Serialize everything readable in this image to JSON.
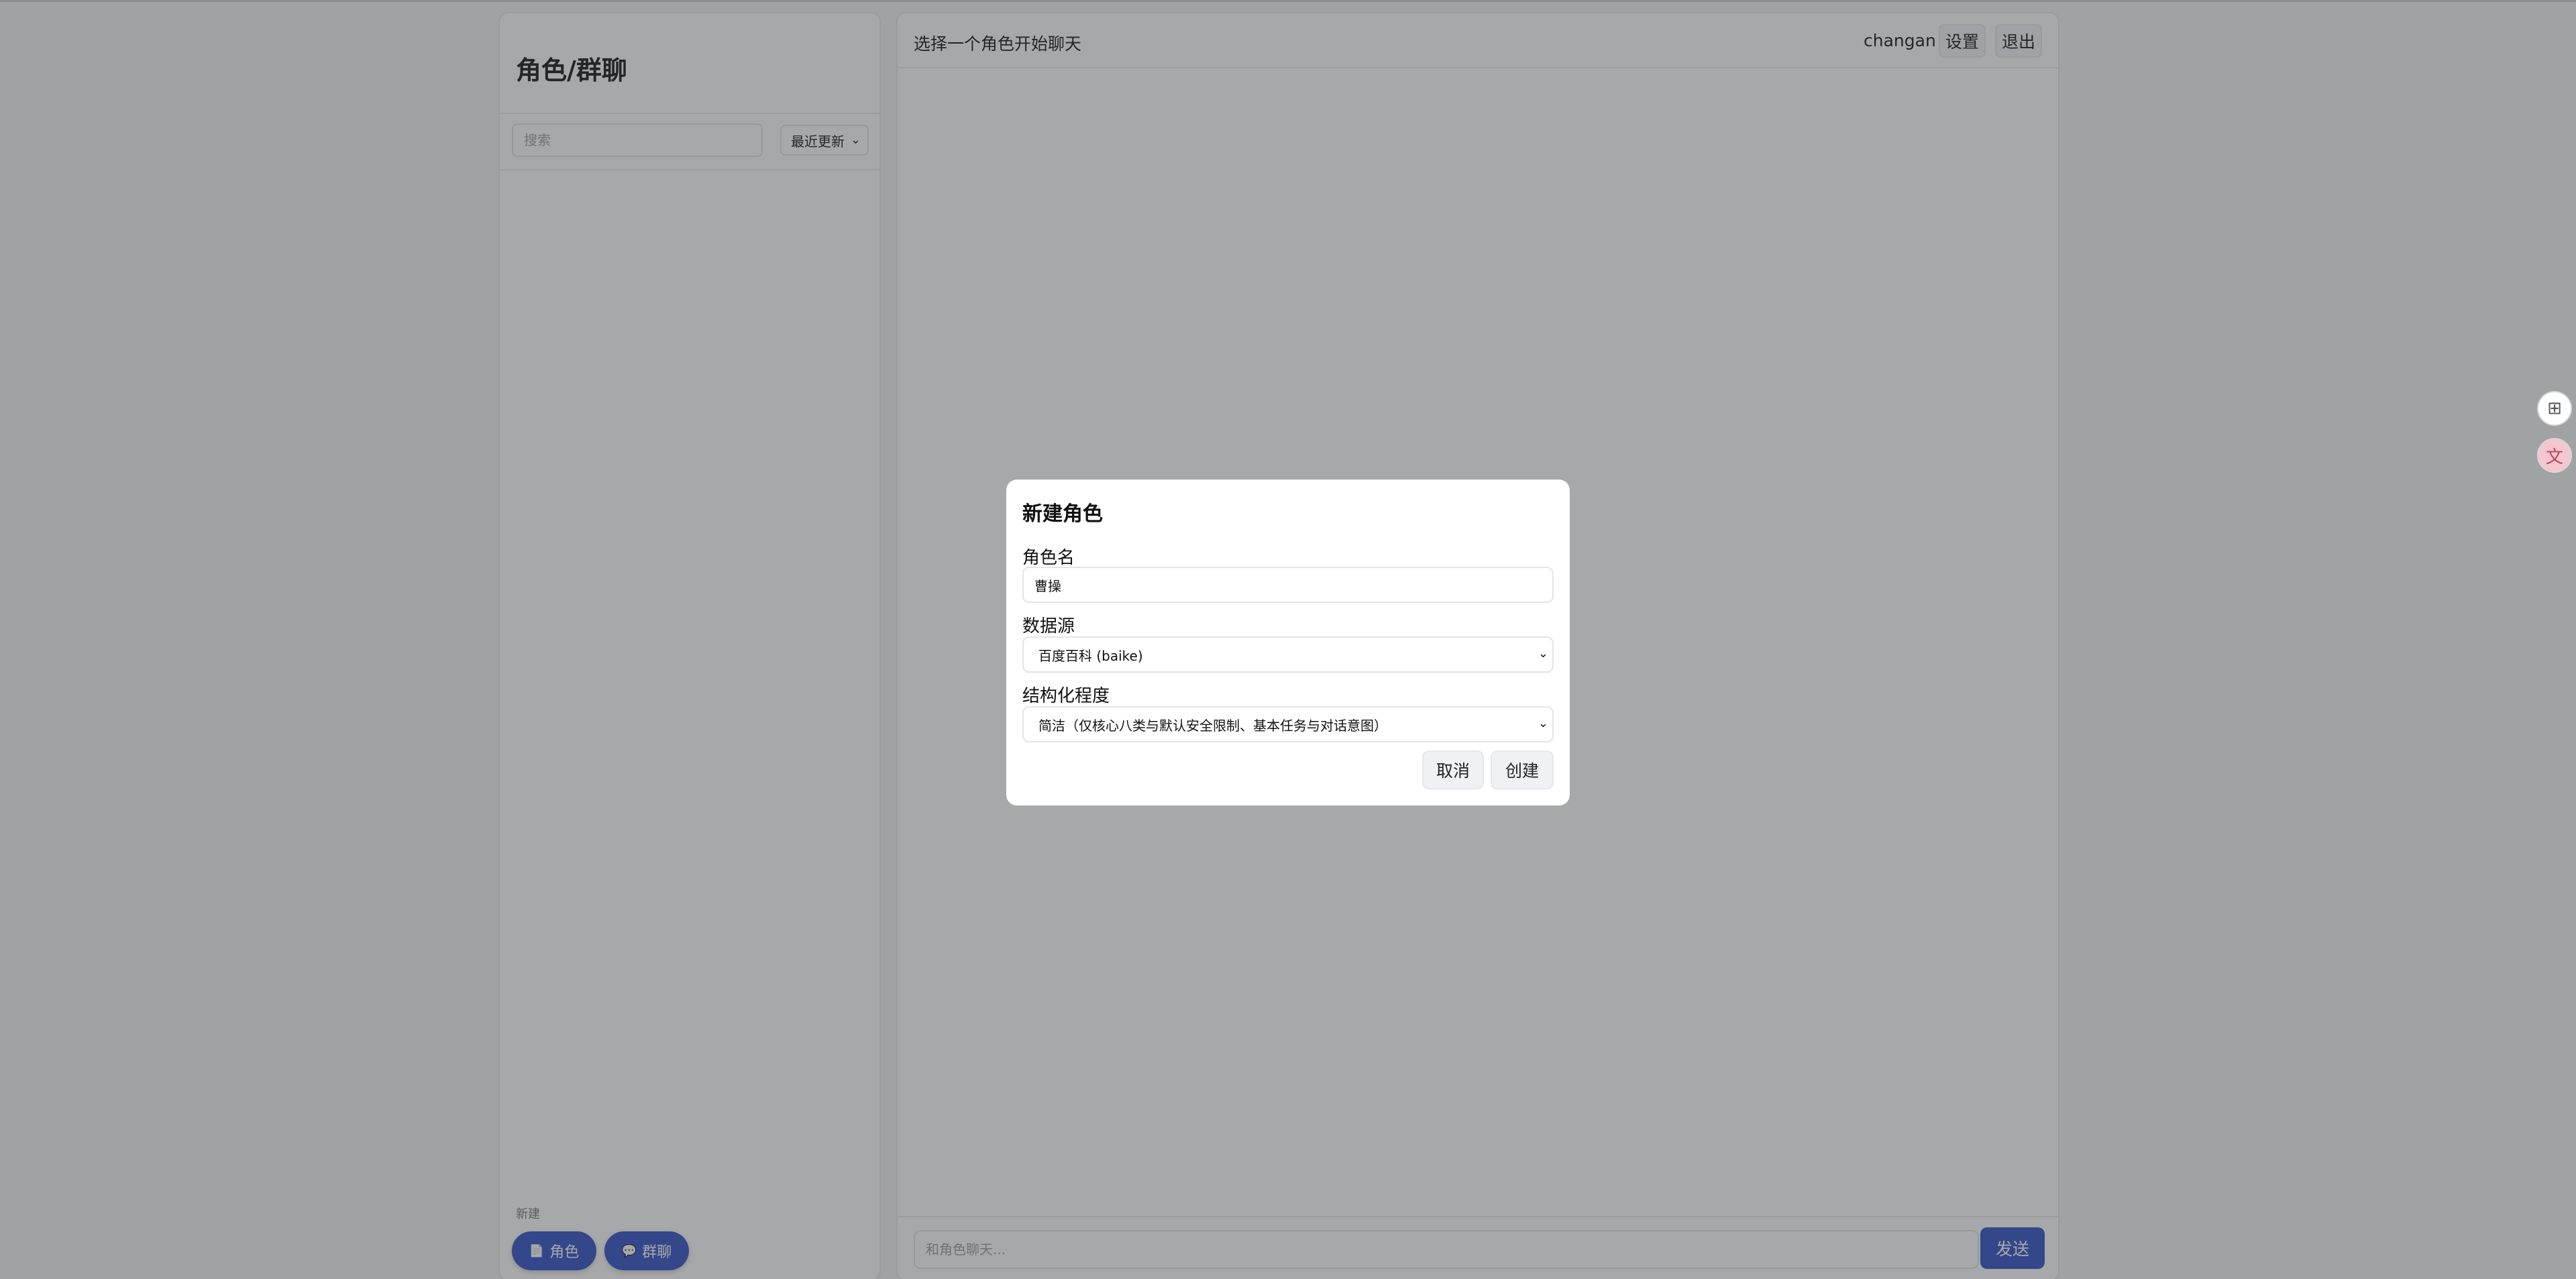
{
  "sidebar": {
    "title": "角色/群聊",
    "search_placeholder": "搜索",
    "sort_value": "最近更新",
    "new_label": "新建",
    "new_role_label": "角色",
    "new_group_label": "群聊"
  },
  "chat": {
    "header_title": "选择一个角色开始聊天",
    "username": "changan",
    "settings_label": "设置",
    "logout_label": "退出",
    "input_placeholder": "和角色聊天...",
    "send_label": "发送"
  },
  "modal": {
    "title": "新建角色",
    "name_label": "角色名",
    "name_value": "曹操",
    "source_label": "数据源",
    "source_value": "百度百科 (baike)",
    "structure_label": "结构化程度",
    "structure_value": "简洁（仅核心八类与默认安全限制、基本任务与对话意图）",
    "cancel_label": "取消",
    "create_label": "创建"
  },
  "icons": {
    "role_icon": "document-icon",
    "group_icon": "chat-bubble-icon",
    "dropdown": "chevron-down-icon"
  },
  "colors": {
    "accent": "#2f4fc6",
    "overlay": "rgba(60,62,64,0.45)"
  }
}
